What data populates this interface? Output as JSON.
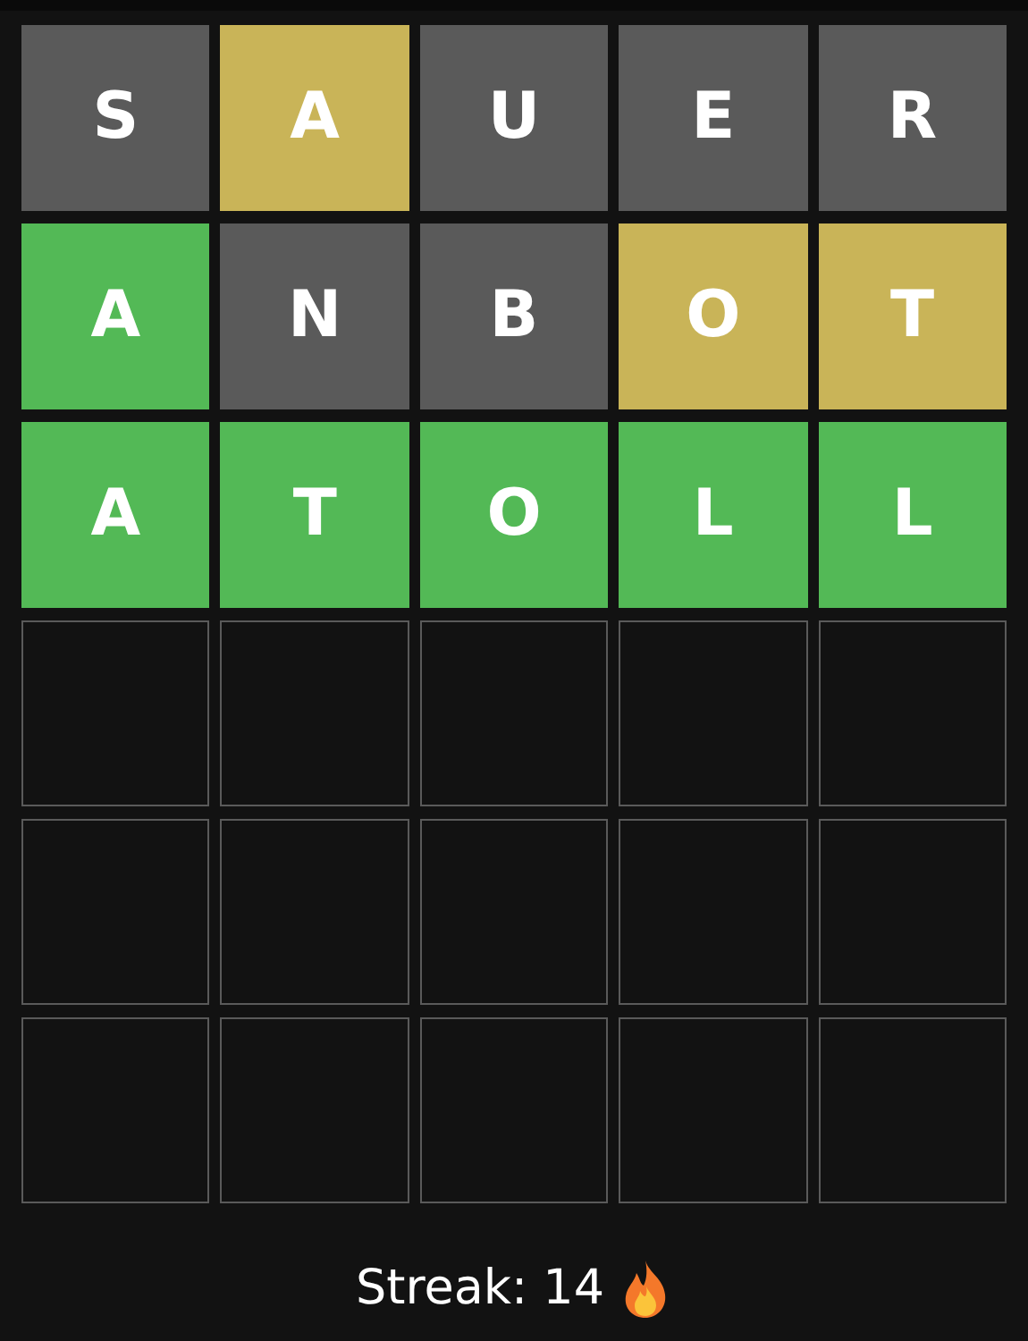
{
  "board": [
    {
      "tiles": [
        {
          "letter": "S",
          "kind": "absent"
        },
        {
          "letter": "A",
          "kind": "present"
        },
        {
          "letter": "U",
          "kind": "absent"
        },
        {
          "letter": "E",
          "kind": "absent"
        },
        {
          "letter": "R",
          "kind": "absent"
        }
      ]
    },
    {
      "tiles": [
        {
          "letter": "A",
          "kind": "correct"
        },
        {
          "letter": "N",
          "kind": "absent"
        },
        {
          "letter": "B",
          "kind": "absent"
        },
        {
          "letter": "O",
          "kind": "present"
        },
        {
          "letter": "T",
          "kind": "present"
        }
      ]
    },
    {
      "tiles": [
        {
          "letter": "A",
          "kind": "correct"
        },
        {
          "letter": "T",
          "kind": "correct"
        },
        {
          "letter": "O",
          "kind": "correct"
        },
        {
          "letter": "L",
          "kind": "correct"
        },
        {
          "letter": "L",
          "kind": "correct"
        }
      ]
    },
    {
      "tiles": [
        {
          "kind": "empty"
        },
        {
          "kind": "empty"
        },
        {
          "kind": "empty"
        },
        {
          "kind": "empty"
        },
        {
          "kind": "empty"
        }
      ]
    },
    {
      "tiles": [
        {
          "kind": "empty"
        },
        {
          "kind": "empty"
        },
        {
          "kind": "empty"
        },
        {
          "kind": "empty"
        },
        {
          "kind": "empty"
        }
      ]
    },
    {
      "tiles": [
        {
          "kind": "empty"
        },
        {
          "kind": "empty"
        },
        {
          "kind": "empty"
        },
        {
          "kind": "empty"
        },
        {
          "kind": "empty"
        }
      ]
    }
  ],
  "streak": {
    "label": "Streak: 14"
  }
}
